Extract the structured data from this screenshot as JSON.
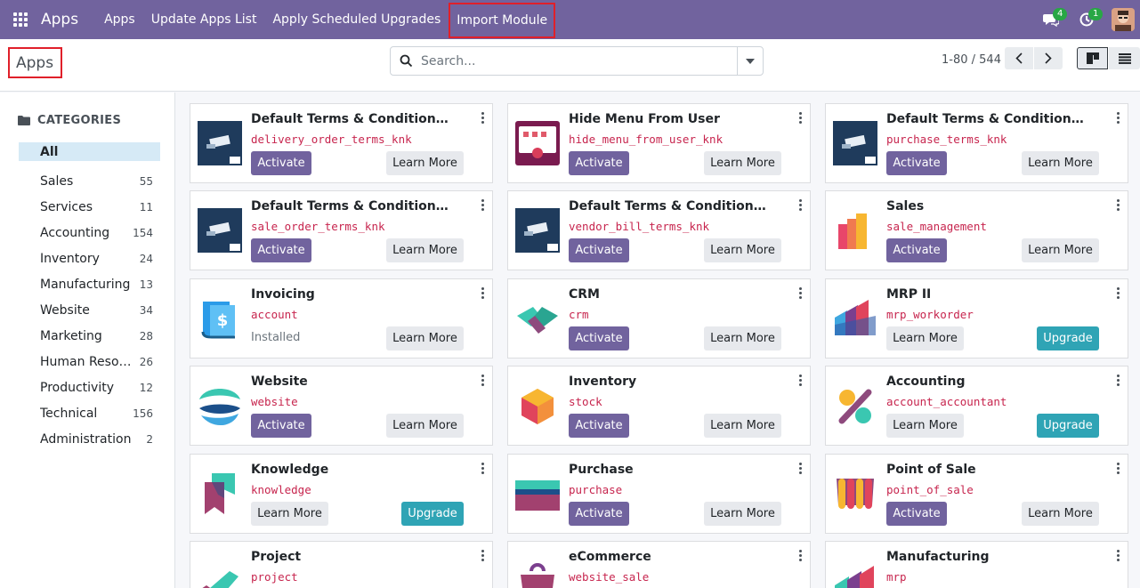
{
  "navbar": {
    "brand": "Apps",
    "links": [
      "Apps",
      "Update Apps List",
      "Apply Scheduled Upgrades",
      "Import Module"
    ],
    "messages_badge": "4",
    "activity_badge": "1"
  },
  "control": {
    "title": "Apps",
    "search_placeholder": "Search...",
    "pager": "1-80 / 544"
  },
  "sidebar": {
    "header": "CATEGORIES",
    "items": [
      {
        "label": "All",
        "count": ""
      },
      {
        "label": "Sales",
        "count": "55"
      },
      {
        "label": "Services",
        "count": "11"
      },
      {
        "label": "Accounting",
        "count": "154"
      },
      {
        "label": "Inventory",
        "count": "24"
      },
      {
        "label": "Manufacturing",
        "count": "13"
      },
      {
        "label": "Website",
        "count": "34"
      },
      {
        "label": "Marketing",
        "count": "28"
      },
      {
        "label": "Human Resources",
        "count": "26"
      },
      {
        "label": "Productivity",
        "count": "12"
      },
      {
        "label": "Technical",
        "count": "156"
      },
      {
        "label": "Administration",
        "count": "2"
      }
    ]
  },
  "labels": {
    "activate": "Activate",
    "learn_more": "Learn More",
    "upgrade": "Upgrade",
    "installed": "Installed"
  },
  "apps": [
    {
      "title": "Default Terms & Conditions ...",
      "tech": "delivery_order_terms_knk",
      "icon": "terms-module-icon"
    },
    {
      "title": "Hide Menu From User",
      "tech": "hide_menu_from_user_knk",
      "icon": "hide-menu-icon"
    },
    {
      "title": "Default Terms & Conditions ...",
      "tech": "purchase_terms_knk",
      "icon": "terms-module-icon"
    },
    {
      "title": "Default Terms & Conditions ...",
      "tech": "sale_order_terms_knk",
      "icon": "terms-module-icon"
    },
    {
      "title": "Default Terms & Conditions ...",
      "tech": "vendor_bill_terms_knk",
      "icon": "terms-module-icon"
    },
    {
      "title": "Sales",
      "tech": "sale_management",
      "icon": "sales-app-icon"
    },
    {
      "title": "Invoicing",
      "tech": "account",
      "icon": "invoicing-app-icon"
    },
    {
      "title": "CRM",
      "tech": "crm",
      "icon": "crm-app-icon"
    },
    {
      "title": "MRP II",
      "tech": "mrp_workorder",
      "icon": "mrp-app-icon"
    },
    {
      "title": "Website",
      "tech": "website",
      "icon": "website-app-icon"
    },
    {
      "title": "Inventory",
      "tech": "stock",
      "icon": "inventory-app-icon"
    },
    {
      "title": "Accounting",
      "tech": "account_accountant",
      "icon": "accounting-app-icon"
    },
    {
      "title": "Knowledge",
      "tech": "knowledge",
      "icon": "knowledge-app-icon"
    },
    {
      "title": "Purchase",
      "tech": "purchase",
      "icon": "purchase-app-icon"
    },
    {
      "title": "Point of Sale",
      "tech": "point_of_sale",
      "icon": "pos-app-icon"
    },
    {
      "title": "Project",
      "tech": "project",
      "icon": "project-app-icon"
    },
    {
      "title": "eCommerce",
      "tech": "website_sale",
      "icon": "ecommerce-app-icon"
    },
    {
      "title": "Manufacturing",
      "tech": "mrp",
      "icon": "manufacturing-app-icon"
    }
  ]
}
